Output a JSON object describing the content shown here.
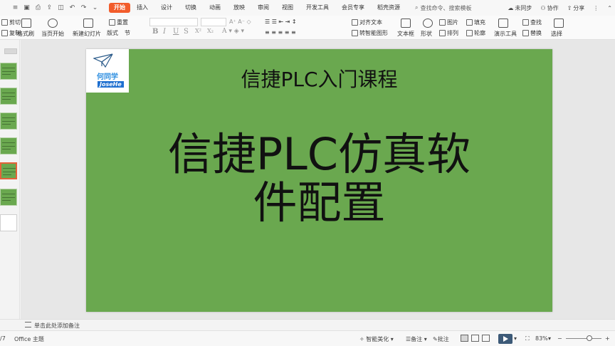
{
  "menubar": {
    "quick_icons": [
      "save-icon",
      "print-icon",
      "export-icon",
      "preview-icon",
      "undo-icon",
      "redo-icon",
      "more-icon"
    ],
    "items": [
      "开始",
      "插入",
      "设计",
      "切换",
      "动画",
      "放映",
      "审阅",
      "视图",
      "开发工具",
      "会员专享",
      "稻壳资源"
    ],
    "active_index": 0,
    "search_text": "查找命令、搜索模板",
    "sync_label": "未同步",
    "collab_label": "协作",
    "share_label": "分享"
  },
  "ribbon": {
    "cut": "剪切",
    "copy": "复制",
    "format_painter": "格式刷",
    "play_from_current": "当页开始",
    "new_slide": "新建幻灯片",
    "layout": "版式",
    "section": "节",
    "reset": "重置",
    "bold": "B",
    "italic": "I",
    "underline": "U",
    "strike": "S",
    "superscript": "X²",
    "subscript": "X₂",
    "text_direction": "文字方向",
    "align_text": "对齐文本",
    "smartart": "转智能图形",
    "textbox": "文本框",
    "shape": "形状",
    "picture": "图片",
    "arrange": "排列",
    "fill": "填充",
    "outline": "轮廓",
    "find": "查找",
    "replace": "替换",
    "presentation_tools": "演示工具",
    "select": "选择"
  },
  "slide": {
    "logo_name": "何同学",
    "logo_signature": "JoseHe",
    "subtitle": "信捷PLC入门课程",
    "title_line1": "信捷PLC仿真软",
    "title_line2": "件配置"
  },
  "thumbnails": {
    "count": 7,
    "selected_index": 4
  },
  "notes": {
    "placeholder": "单击此处添加备注"
  },
  "status": {
    "slide_counter": "/7",
    "theme": "Office 主题",
    "smart_beautify": "智能美化",
    "notes_btn": "备注",
    "comment_btn": "批注",
    "zoom": "83%",
    "zoom_level": 0.83
  },
  "colors": {
    "slide_bg": "#6aa84f",
    "accent": "#f25c2b",
    "logo_blue": "#1e6fd0"
  }
}
